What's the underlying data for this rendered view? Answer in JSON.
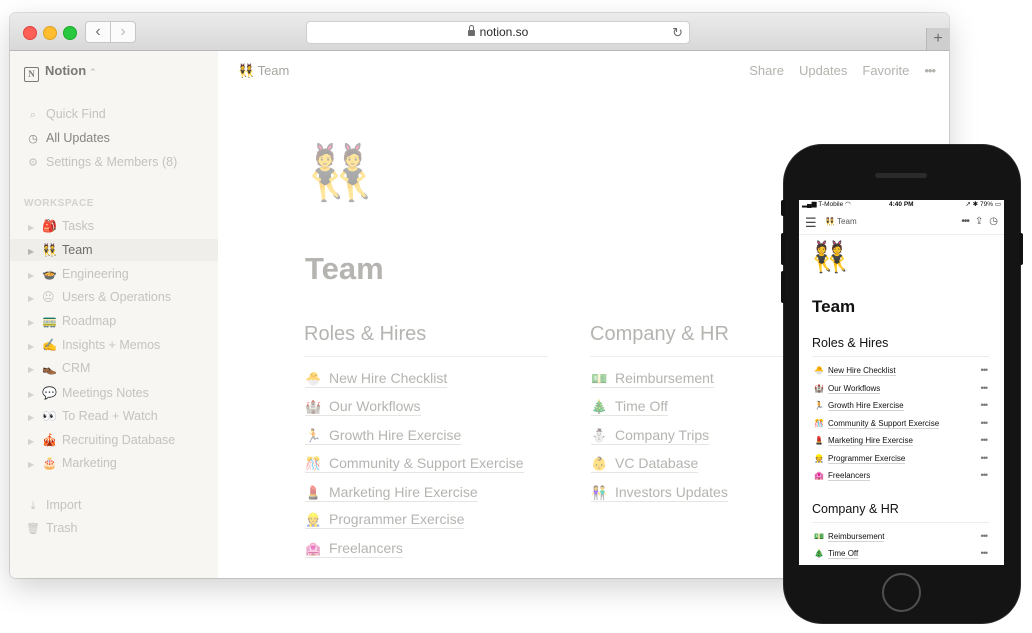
{
  "browser": {
    "url": "notion.so",
    "new_tab_label": "+",
    "back_glyph": "‹",
    "forward_glyph": "›"
  },
  "sidebar": {
    "workspace_name": "Notion",
    "workspace_chevron": "⌃",
    "quick_links": [
      {
        "label": "Quick Find",
        "icon": "search-icon",
        "glyph": "⌕"
      },
      {
        "label": "All Updates",
        "icon": "clock-icon",
        "glyph": "◷"
      },
      {
        "label": "Settings & Members (8)",
        "icon": "gear-icon",
        "glyph": "⚙"
      }
    ],
    "section_label": "WORKSPACE",
    "pages": [
      {
        "label": "Tasks",
        "emoji": "🎒"
      },
      {
        "label": "Team",
        "emoji": "👯"
      },
      {
        "label": "Engineering",
        "emoji": "🍲"
      },
      {
        "label": "Users & Operations",
        "emoji": "😐"
      },
      {
        "label": "Roadmap",
        "emoji": "🚃"
      },
      {
        "label": "Insights + Memos",
        "emoji": "✍️"
      },
      {
        "label": "CRM",
        "emoji": "👞"
      },
      {
        "label": "Meetings Notes",
        "emoji": "💬"
      },
      {
        "label": "To Read + Watch",
        "emoji": "👀"
      },
      {
        "label": "Recruiting Database",
        "emoji": "🎪"
      },
      {
        "label": "Marketing",
        "emoji": "🎂"
      }
    ],
    "footer_links": [
      {
        "label": "Import",
        "icon": "import-icon",
        "glyph": "⤓"
      },
      {
        "label": "Trash",
        "icon": "trash-icon",
        "glyph": "🗑"
      }
    ]
  },
  "topbar": {
    "crumb_emoji": "👯",
    "crumb_label": "Team",
    "share": "Share",
    "updates": "Updates",
    "favorite": "Favorite",
    "more": "•••"
  },
  "page": {
    "icon": "👯",
    "title": "Team",
    "columns": [
      {
        "heading": "Roles & Hires",
        "links": [
          {
            "emoji": "🐣",
            "label": "New Hire Checklist"
          },
          {
            "emoji": "🏰",
            "label": "Our Workflows"
          },
          {
            "emoji": "🏃",
            "label": "Growth Hire Exercise"
          },
          {
            "emoji": "🎊",
            "label": "Community & Support Exercise"
          },
          {
            "emoji": "💄",
            "label": "Marketing Hire Exercise"
          },
          {
            "emoji": "👷",
            "label": "Programmer Exercise"
          },
          {
            "emoji": "🏩",
            "label": "Freelancers"
          }
        ]
      },
      {
        "heading": "Company & HR",
        "links": [
          {
            "emoji": "💵",
            "label": "Reimbursement"
          },
          {
            "emoji": "🎄",
            "label": "Time Off"
          },
          {
            "emoji": "⛄",
            "label": "Company Trips"
          },
          {
            "emoji": "👶",
            "label": "VC Database"
          },
          {
            "emoji": "👫",
            "label": "Investors Updates"
          }
        ]
      }
    ]
  },
  "mobile": {
    "carrier": "T-Mobile",
    "time": "4:40 PM",
    "battery": "79%",
    "crumb_emoji": "👯",
    "crumb_label": "Team",
    "menu_glyph": "☰",
    "more": "•••",
    "share_glyph": "⇪",
    "history_glyph": "◷",
    "icon": "👯",
    "title": "Team",
    "roles_heading": "Roles & Hires",
    "roles_links": [
      {
        "emoji": "🐣",
        "label": "New Hire Checklist"
      },
      {
        "emoji": "🏰",
        "label": "Our Workflows"
      },
      {
        "emoji": "🏃",
        "label": "Growth Hire Exercise"
      },
      {
        "emoji": "🎊",
        "label": "Community & Support Exercise"
      },
      {
        "emoji": "💄",
        "label": "Marketing Hire Exercise"
      },
      {
        "emoji": "👷",
        "label": "Programmer Exercise"
      },
      {
        "emoji": "🏩",
        "label": "Freelancers"
      }
    ],
    "hr_heading": "Company & HR",
    "hr_links": [
      {
        "emoji": "💵",
        "label": "Reimbursement"
      },
      {
        "emoji": "🎄",
        "label": "Time Off"
      }
    ],
    "row_more": "•••"
  },
  "colors": {
    "sidebar_bg": "#f7f6f3",
    "text": "#37352f",
    "muted": "#b5b4b0"
  }
}
